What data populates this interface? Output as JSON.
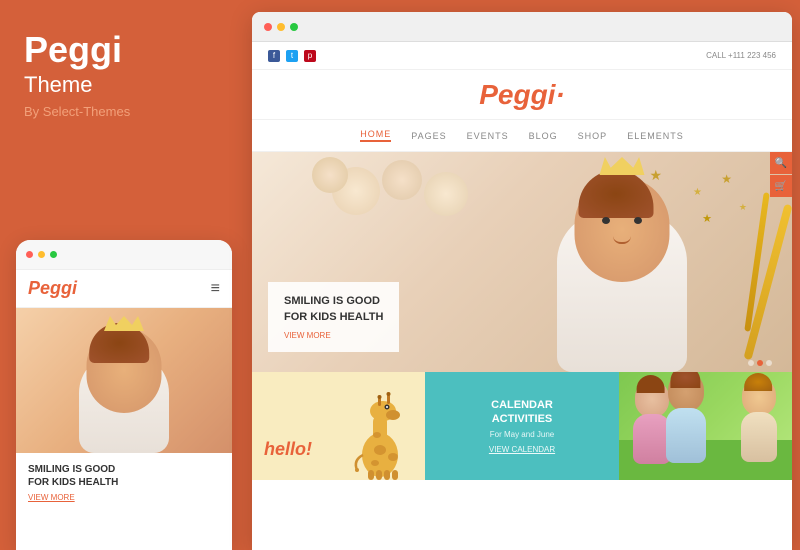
{
  "left_panel": {
    "title": "Peggi",
    "subtitle": "Theme",
    "byline": "By Select-Themes"
  },
  "mobile": {
    "logo": "Peggi",
    "hamburger": "≡",
    "caption_title": "SMILING IS GOOD\nFOR KIDS HEALTH",
    "view_more": "VIEW MORE",
    "dots": [
      "red",
      "yellow",
      "green"
    ]
  },
  "browser": {
    "dots": [
      "red",
      "yellow",
      "green"
    ]
  },
  "site": {
    "social_icons": [
      "f",
      "t",
      "p"
    ],
    "call_text": "CALL  +111 223 456",
    "logo": "Peggi·",
    "nav_items": [
      "HOME",
      "PAGES",
      "EVENTS",
      "BLOG",
      "SHOP",
      "ELEMENTS"
    ],
    "active_nav": "HOME",
    "hero_headline": "SMILING IS GOOD\nFOR KIDS HEALTH",
    "hero_view_more": "VIEW MORE",
    "calendar": {
      "title": "CALENDAR\nACTIVITIES",
      "subtitle": "For May and June",
      "link": "VIEW CALENDAR"
    },
    "hello_text": "hello!",
    "grid_bg_colors": [
      "#f9ecc0",
      "#4cbfbf",
      "#a8d870"
    ]
  }
}
